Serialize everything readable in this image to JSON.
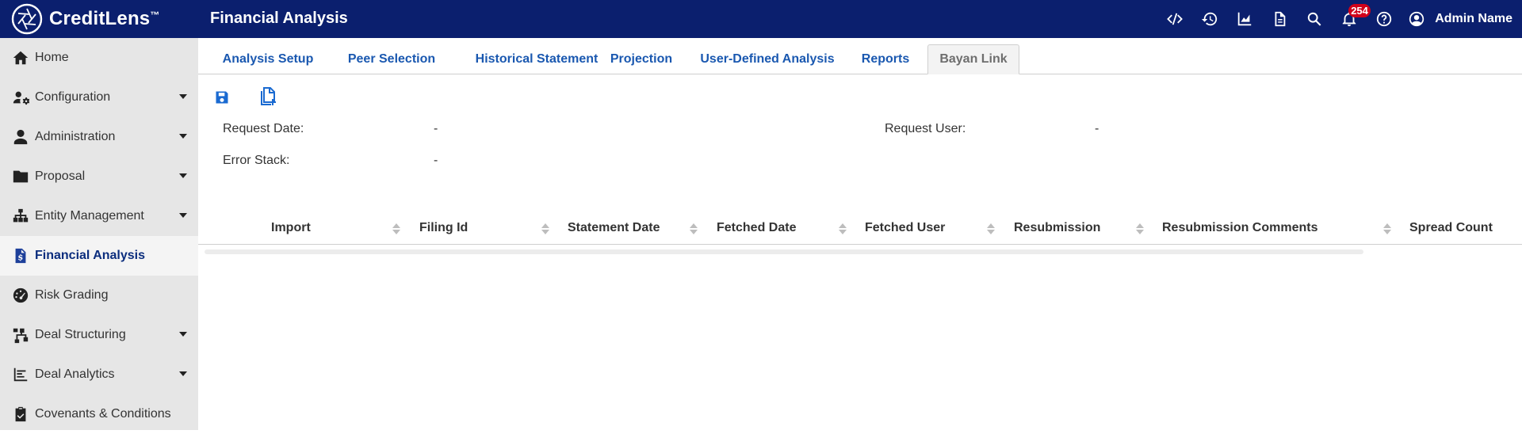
{
  "app": {
    "brand": "CreditLens",
    "trademark": "™",
    "page_title": "Financial Analysis"
  },
  "topbar": {
    "icons": [
      "code-icon",
      "history-icon",
      "chart-area-icon",
      "document-icon",
      "search-icon",
      "bell-icon",
      "help-icon",
      "user-circle-icon"
    ],
    "notification_count": "254",
    "user_name": "Admin Name"
  },
  "sidebar": {
    "items": [
      {
        "label": "Home",
        "icon": "home-icon",
        "expandable": false
      },
      {
        "label": "Configuration",
        "icon": "user-gear-icon",
        "expandable": true
      },
      {
        "label": "Administration",
        "icon": "user-icon",
        "expandable": true
      },
      {
        "label": "Proposal",
        "icon": "folder-icon",
        "expandable": true
      },
      {
        "label": "Entity Management",
        "icon": "sitemap-icon",
        "expandable": true
      },
      {
        "label": "Financial Analysis",
        "icon": "file-dollar-icon",
        "expandable": false,
        "active": true
      },
      {
        "label": "Risk Grading",
        "icon": "gauge-icon",
        "expandable": false
      },
      {
        "label": "Deal Structuring",
        "icon": "diagram-icon",
        "expandable": true
      },
      {
        "label": "Deal Analytics",
        "icon": "bar-chart-icon",
        "expandable": true
      },
      {
        "label": "Covenants & Conditions",
        "icon": "clipboard-check-icon",
        "expandable": false
      }
    ]
  },
  "tabs": [
    {
      "label": "Analysis Setup"
    },
    {
      "label": "Peer Selection"
    },
    {
      "label": "Historical Statement"
    },
    {
      "label": "Projection"
    },
    {
      "label": "User-Defined Analysis"
    },
    {
      "label": "Reports"
    },
    {
      "label": "Bayan Link",
      "active": true
    }
  ],
  "toolbar": {
    "icons": [
      "save-icon",
      "copy-icon"
    ]
  },
  "fields": {
    "request_date_label": "Request Date:",
    "request_date_value": "-",
    "request_user_label": "Request User:",
    "request_user_value": "-",
    "error_stack_label": "Error Stack:",
    "error_stack_value": "-"
  },
  "grid": {
    "columns": [
      "Import",
      "Filing Id",
      "Statement Date",
      "Fetched Date",
      "Fetched User",
      "Resubmission",
      "Resubmission Comments",
      "Spread Count"
    ],
    "rows": []
  },
  "colors": {
    "topbar": "#0b1f6e",
    "sidebar": "#e6e6e6",
    "link": "#1a58b0",
    "badge": "#d0021b"
  }
}
